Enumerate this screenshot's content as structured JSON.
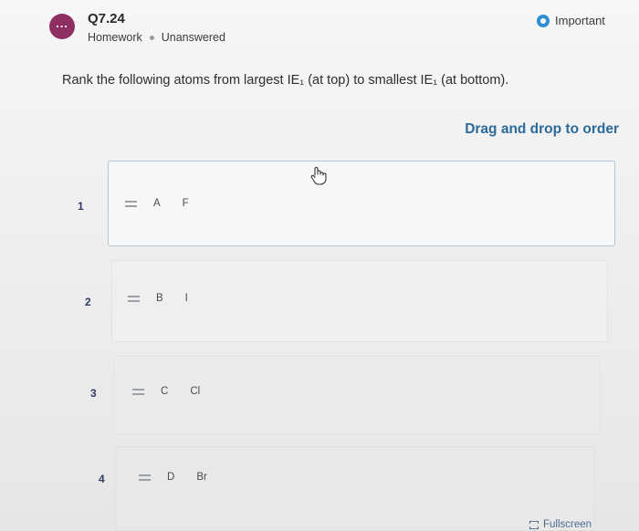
{
  "question": {
    "avatar_text": "...",
    "title": "Q7.24",
    "category": "Homework",
    "status": "Unanswered",
    "important_label": "Important",
    "prompt": "Rank the following atoms from largest IE₁ (at top) to smallest IE₁ (at bottom)."
  },
  "ranking": {
    "hint": "Drag and drop to order",
    "items": [
      {
        "rank": "1",
        "letter": "A",
        "symbol": "F"
      },
      {
        "rank": "2",
        "letter": "B",
        "symbol": "I"
      },
      {
        "rank": "3",
        "letter": "C",
        "symbol": "Cl"
      },
      {
        "rank": "4",
        "letter": "D",
        "symbol": "Br"
      }
    ]
  },
  "footer": {
    "fullscreen_label": "Fullscreen"
  },
  "colors": {
    "avatar": "#8f2e63",
    "important_icon": "#2d8fcf",
    "hint_text": "#2c6a9a",
    "rank_number": "#2f3d66"
  },
  "icons": {
    "avatar": "ellipsis-icon",
    "important": "radio-dot-icon",
    "grip": "drag-handle-icon",
    "cursor": "hand-pointer-icon",
    "fullscreen": "fullscreen-icon"
  }
}
